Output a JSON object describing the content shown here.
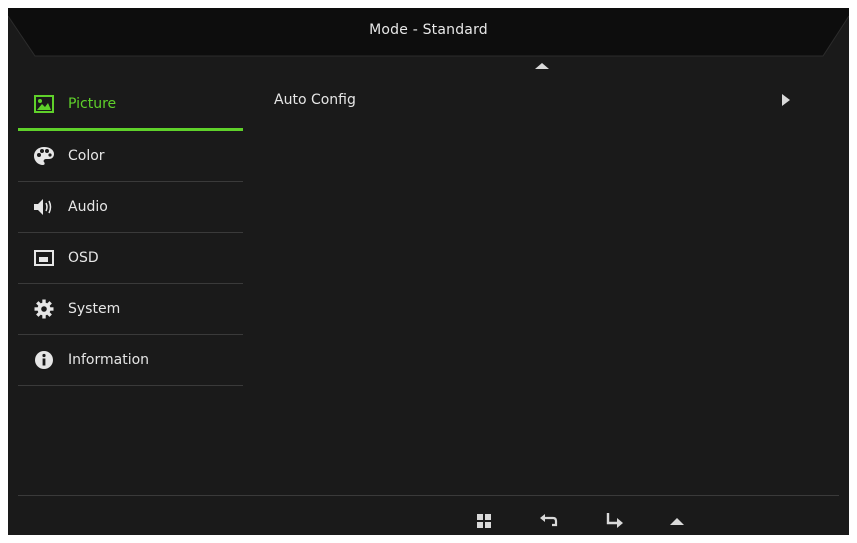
{
  "header": {
    "title": "Mode - Standard"
  },
  "sidebar": {
    "items": [
      {
        "label": "Picture",
        "icon": "picture-icon",
        "active": true
      },
      {
        "label": "Color",
        "icon": "palette-icon",
        "active": false
      },
      {
        "label": "Audio",
        "icon": "speaker-icon",
        "active": false
      },
      {
        "label": "OSD",
        "icon": "osd-window-icon",
        "active": false
      },
      {
        "label": "System",
        "icon": "gear-icon",
        "active": false
      },
      {
        "label": "Information",
        "icon": "info-icon",
        "active": false
      }
    ]
  },
  "content": {
    "items": [
      {
        "label": "Auto Config",
        "icon": "chevron-right-icon"
      }
    ]
  },
  "footer": {
    "buttons": [
      "menu-grid-icon",
      "back-arrow-icon",
      "enter-arrow-icon",
      "up-arrow-icon"
    ]
  },
  "colors": {
    "background": "#1a1a1a",
    "accent": "#5fd12a",
    "text": "#e6e6e6",
    "divider": "#3a3a3a"
  }
}
